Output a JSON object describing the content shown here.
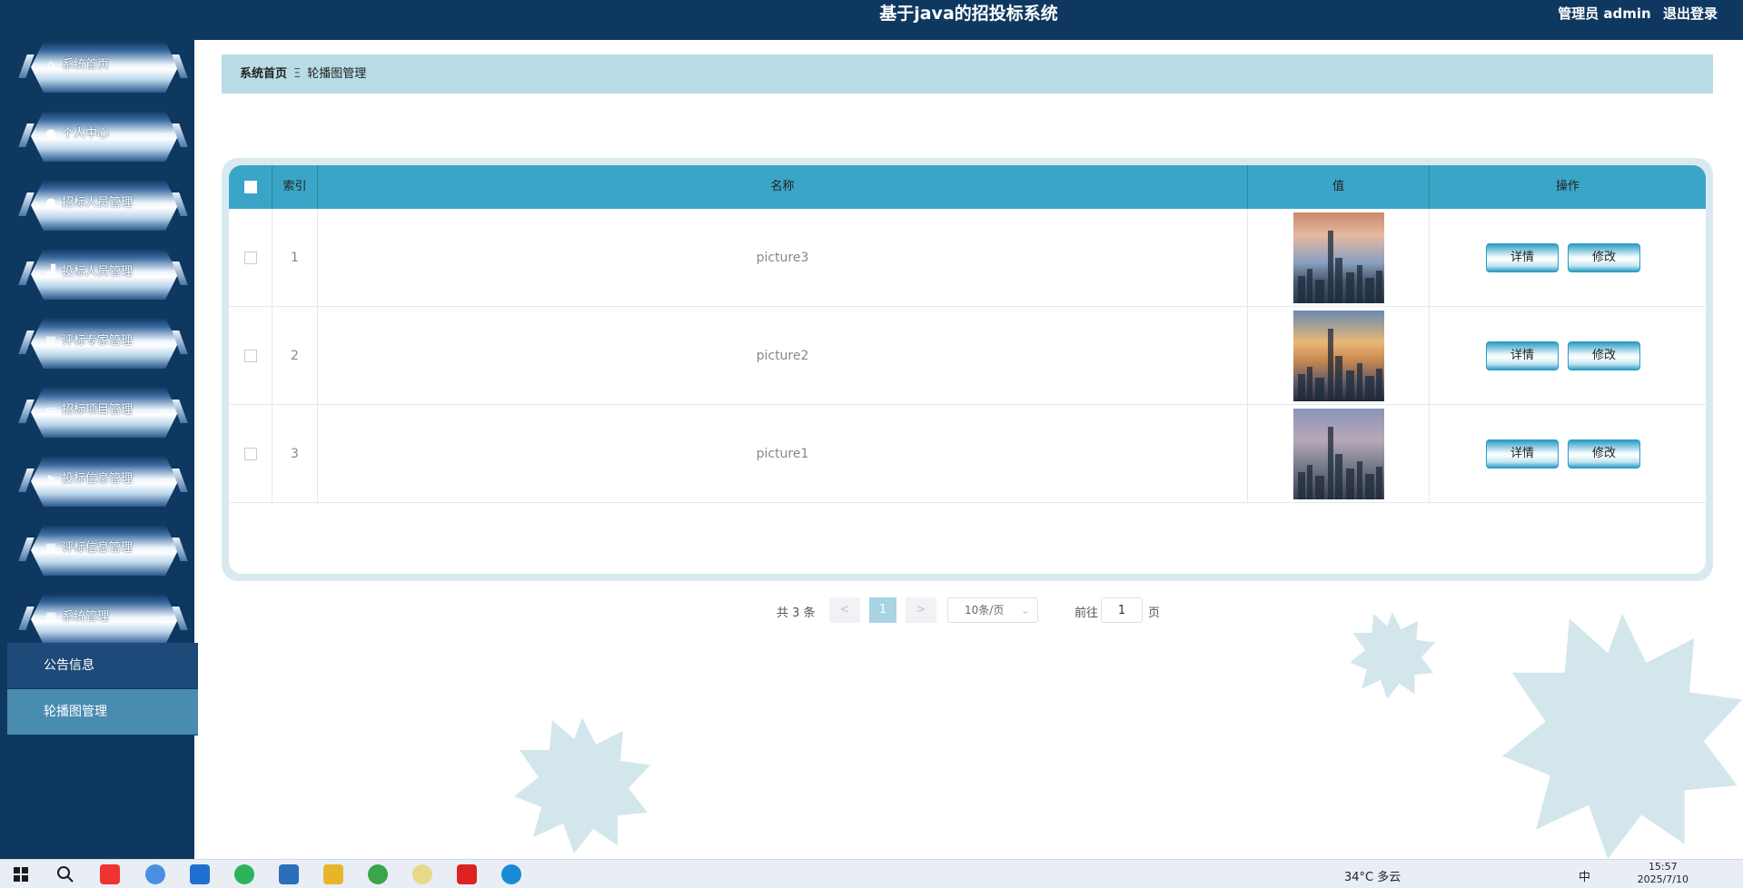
{
  "header": {
    "title": "基于java的招投标系统",
    "user_label": "管理员 admin",
    "logout_label": "退出登录"
  },
  "sidebar": {
    "items": [
      {
        "label": "系统首页",
        "icon": "home-icon",
        "has_children": false
      },
      {
        "label": "个人中心",
        "icon": "user-icon",
        "has_children": true
      },
      {
        "label": "招标人员管理",
        "icon": "user-icon",
        "has_children": true
      },
      {
        "label": "投标人员管理",
        "icon": "chart-icon",
        "has_children": true
      },
      {
        "label": "评标专家管理",
        "icon": "grid-icon",
        "has_children": true
      },
      {
        "label": "招标项目管理",
        "icon": "monitor-icon",
        "has_children": true
      },
      {
        "label": "投标信息管理",
        "icon": "send-icon",
        "has_children": true
      },
      {
        "label": "评标信息管理",
        "icon": "grid-icon",
        "has_children": true
      },
      {
        "label": "系统管理",
        "icon": "grid-icon",
        "has_children": true
      }
    ],
    "submenu": [
      {
        "label": "公告信息",
        "active": false
      },
      {
        "label": "轮播图管理",
        "active": true
      }
    ]
  },
  "breadcrumb": {
    "home": "系统首页",
    "separator": "Ξ",
    "current": "轮播图管理"
  },
  "table": {
    "columns": [
      "",
      "索引",
      "名称",
      "值",
      "操作"
    ],
    "rows": [
      {
        "index": "1",
        "name": "picture3",
        "thumb": "city-skyline-sunset-rays"
      },
      {
        "index": "2",
        "name": "picture2",
        "thumb": "city-skyline-tower-sunrise"
      },
      {
        "index": "3",
        "name": "picture1",
        "thumb": "city-skyline-dusk"
      }
    ],
    "detail_label": "详情",
    "edit_label": "修改"
  },
  "pagination": {
    "total_text": "共 3 条",
    "prev": "<",
    "current": "1",
    "next": ">",
    "page_size": "10条/页",
    "goto_label": "前往",
    "goto_value": "1",
    "page_suffix": "页"
  },
  "taskbar": {
    "weather": "34°C 多云",
    "ime": "中",
    "time": "15:57",
    "date": "2025/7/10"
  },
  "colors": {
    "primary_dark": "#0f3860",
    "table_header": "#3aa5c6",
    "breadcrumb_bg": "#b8dce6",
    "active_sub": "#4a8cb0"
  }
}
